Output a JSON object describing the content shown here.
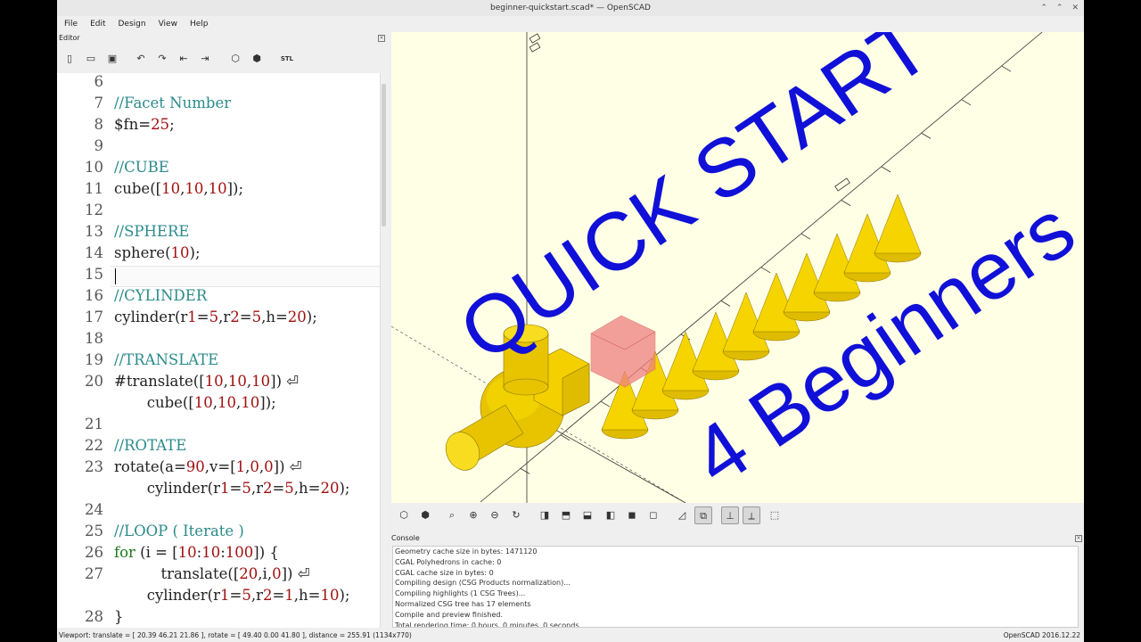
{
  "window": {
    "title": "beginner-quickstart.scad* — OpenSCAD"
  },
  "menu": [
    {
      "label": "File"
    },
    {
      "label": "Edit"
    },
    {
      "label": "Design"
    },
    {
      "label": "View"
    },
    {
      "label": "Help"
    }
  ],
  "editor": {
    "title": "Editor",
    "lines": [
      {
        "n": "6",
        "text": ""
      },
      {
        "n": "7",
        "text": "//Facet Number"
      },
      {
        "n": "8",
        "text": "$fn=25;"
      },
      {
        "n": "9",
        "text": ""
      },
      {
        "n": "10",
        "text": "//CUBE"
      },
      {
        "n": "11",
        "text": "cube([10,10,10]);"
      },
      {
        "n": "12",
        "text": ""
      },
      {
        "n": "13",
        "text": "//SPHERE"
      },
      {
        "n": "14",
        "text": "sphere(10);"
      },
      {
        "n": "15",
        "text": ""
      },
      {
        "n": "16",
        "text": "//CYLINDER"
      },
      {
        "n": "17",
        "text": "cylinder(r1=5,r2=5,h=20);"
      },
      {
        "n": "18",
        "text": ""
      },
      {
        "n": "19",
        "text": "//TRANSLATE"
      },
      {
        "n": "20",
        "text": "#translate([10,10,10]) ⏎"
      },
      {
        "n": "",
        "text": "       cube([10,10,10]);"
      },
      {
        "n": "21",
        "text": ""
      },
      {
        "n": "22",
        "text": "//ROTATE"
      },
      {
        "n": "23",
        "text": "rotate(a=90,v=[1,0,0]) ⏎"
      },
      {
        "n": "",
        "text": "       cylinder(r1=5,r2=5,h=20);"
      },
      {
        "n": "24",
        "text": ""
      },
      {
        "n": "25",
        "text": "//LOOP ( Iterate )"
      },
      {
        "n": "26",
        "text": "for (i = [10:10:100]) {"
      },
      {
        "n": "27",
        "text": "          translate([20,i,0]) ⏎"
      },
      {
        "n": "",
        "text": "       cylinder(r1=5,r2=1,h=10);"
      },
      {
        "n": "28",
        "text": "}"
      }
    ]
  },
  "overlay": {
    "line1": "QUICK START",
    "line2": "4 Beginners"
  },
  "console": {
    "title": "Console",
    "lines": [
      "Geometry cache size in bytes: 1471120",
      "CGAL Polyhedrons in cache: 0",
      "CGAL cache size in bytes: 0",
      "Compiling design (CSG Products normalization)...",
      "Compiling highlights (1 CSG Trees)...",
      "Normalized CSG tree has 17 elements",
      "Compile and preview finished.",
      "Total rendering time: 0 hours, 0 minutes, 0 seconds"
    ]
  },
  "status": {
    "viewport": "Viewport: translate = [ 20.39 46.21 21.86 ], rotate = [ 49.40 0.00 41.80 ], distance = 255.91 (1134x770)",
    "version": "OpenSCAD 2016.12.22"
  },
  "colors": {
    "viewport_bg": "#ffffe5",
    "model": "#f5d400",
    "highlight": "#f08080",
    "overlay_text": "#1010d8"
  }
}
